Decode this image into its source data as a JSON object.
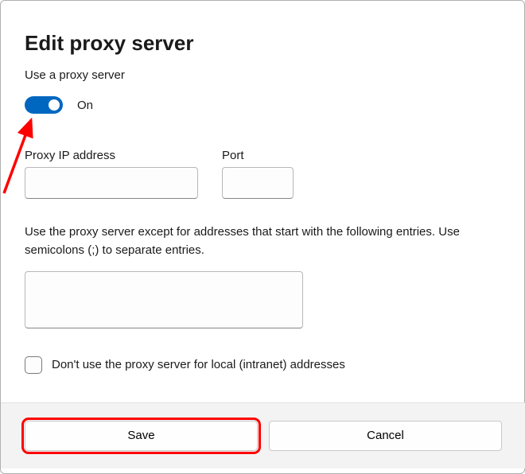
{
  "dialog": {
    "title": "Edit proxy server",
    "subtitle": "Use a proxy server"
  },
  "toggle": {
    "state_label": "On",
    "on": true
  },
  "fields": {
    "ip_label": "Proxy IP address",
    "ip_value": "",
    "port_label": "Port",
    "port_value": ""
  },
  "exceptions": {
    "text": "Use the proxy server except for addresses that start with the following entries. Use semicolons (;) to separate entries.",
    "value": ""
  },
  "checkbox": {
    "label": "Don't use the proxy server for local (intranet) addresses",
    "checked": false
  },
  "buttons": {
    "save": "Save",
    "cancel": "Cancel"
  },
  "annotations": {
    "arrow_target": "toggle",
    "highlight_target": "save-button"
  },
  "colors": {
    "accent": "#0067c0",
    "highlight": "#ff0000"
  }
}
